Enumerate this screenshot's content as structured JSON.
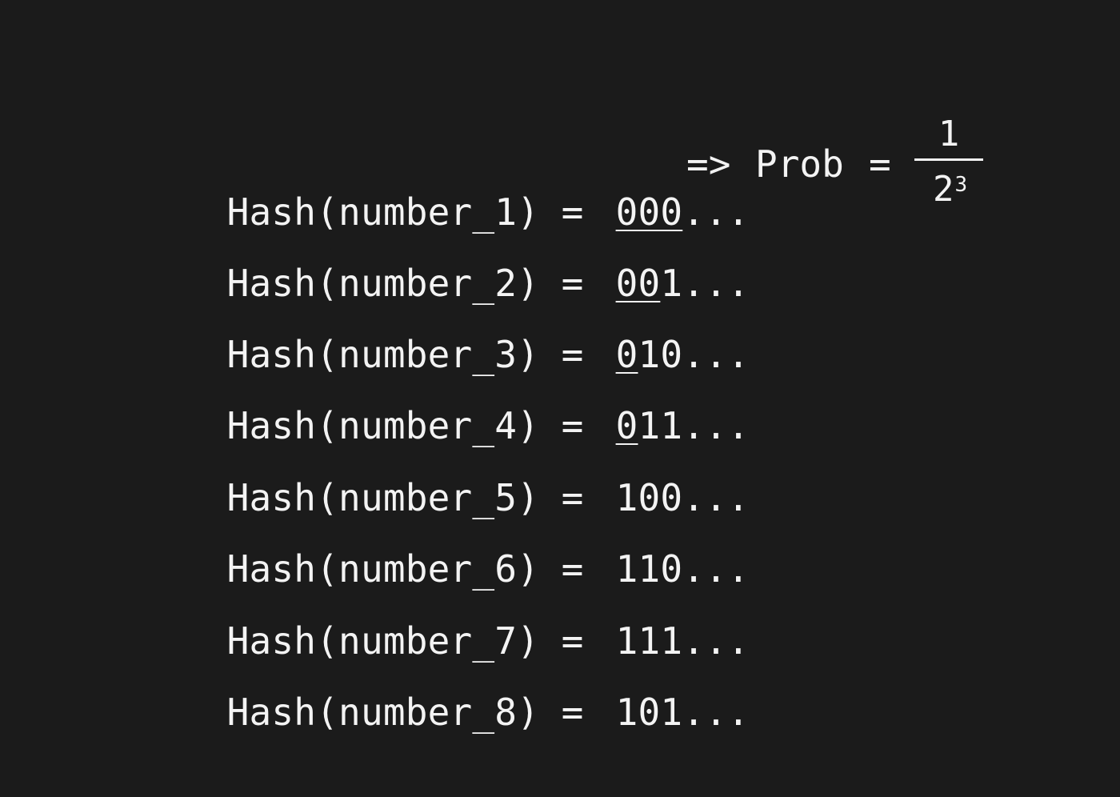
{
  "rows": [
    {
      "expr": "Hash(number_1)",
      "eq": "=",
      "hash_underlined": "000",
      "hash_rest": "",
      "ellipsis": "..."
    },
    {
      "expr": "Hash(number_2)",
      "eq": "=",
      "hash_underlined": "00",
      "hash_rest": "1",
      "ellipsis": "..."
    },
    {
      "expr": "Hash(number_3)",
      "eq": "=",
      "hash_underlined": "0",
      "hash_rest": "10",
      "ellipsis": "..."
    },
    {
      "expr": "Hash(number_4)",
      "eq": "=",
      "hash_underlined": "0",
      "hash_rest": "11",
      "ellipsis": "..."
    },
    {
      "expr": "Hash(number_5)",
      "eq": "=",
      "hash_underlined": "",
      "hash_rest": "100",
      "ellipsis": "..."
    },
    {
      "expr": "Hash(number_6)",
      "eq": "=",
      "hash_underlined": "",
      "hash_rest": "110",
      "ellipsis": "..."
    },
    {
      "expr": "Hash(number_7)",
      "eq": "=",
      "hash_underlined": "",
      "hash_rest": "111",
      "ellipsis": "..."
    },
    {
      "expr": "Hash(number_8)",
      "eq": "=",
      "hash_underlined": "",
      "hash_rest": "101",
      "ellipsis": "..."
    }
  ],
  "probability": {
    "arrow": "=>",
    "label": "Prob",
    "eq": "=",
    "numerator": "1",
    "denominator_base": "2",
    "denominator_exponent": "3"
  },
  "colors": {
    "background": "#1b1b1b",
    "text": "#f3f3f3"
  }
}
